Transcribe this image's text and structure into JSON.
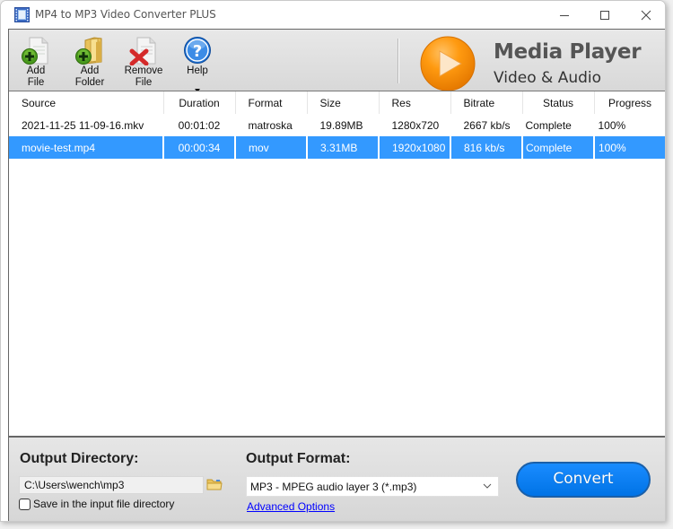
{
  "window": {
    "title": "MP4 to MP3 Video Converter PLUS",
    "icon": "film-strip-icon",
    "controls": {
      "minimize": "minimize-icon",
      "maximize": "maximize-icon",
      "close": "close-icon"
    }
  },
  "toolbar": {
    "buttons": [
      {
        "line1": "Add",
        "line2": "File",
        "icon": "add-file-icon"
      },
      {
        "line1": "Add",
        "line2": "Folder",
        "icon": "add-folder-icon"
      },
      {
        "line1": "Remove",
        "line2": "File",
        "icon": "remove-file-icon"
      },
      {
        "line1": "Help",
        "line2": "",
        "icon": "help-icon",
        "has_dropdown": true
      }
    ]
  },
  "branding": {
    "title": "Media Player",
    "subtitle": "Video & Audio",
    "icon": "play-icon",
    "accent_color": "#ff9900"
  },
  "file_list": {
    "columns": [
      "Source",
      "Duration",
      "Format",
      "Size",
      "Res",
      "Bitrate",
      "Status",
      "Progress"
    ],
    "rows": [
      {
        "source": "2021-11-25 11-09-16.mkv",
        "duration": "00:01:02",
        "format": "matroska",
        "size": "19.89MB",
        "res": "1280x720",
        "bitrate": "2667 kb/s",
        "status": "Complete",
        "progress": "100%",
        "selected": false
      },
      {
        "source": "movie-test.mp4",
        "duration": "00:00:34",
        "format": "mov",
        "size": "3.31MB",
        "res": "1920x1080",
        "bitrate": "816 kb/s",
        "status": "Complete",
        "progress": "100%",
        "selected": true
      }
    ],
    "selection_color": "#3399ff"
  },
  "output": {
    "directory_label": "Output Directory:",
    "directory_value": "C:\\Users\\wench\\mp3",
    "save_in_input_label": "Save in the input file directory",
    "save_in_input_checked": false,
    "format_label": "Output Format:",
    "format_value": "MP3 - MPEG audio layer 3 (*.mp3)",
    "advanced_options_label": "Advanced Options",
    "convert_label": "Convert",
    "convert_color": "#0a7ff5"
  }
}
